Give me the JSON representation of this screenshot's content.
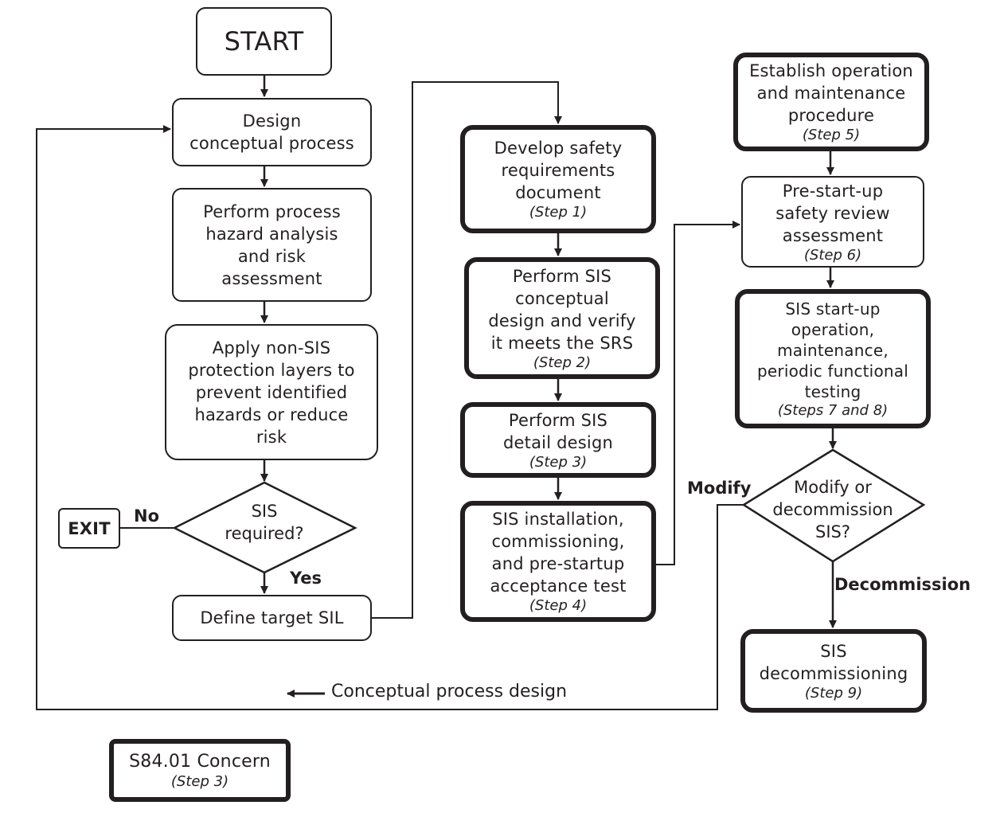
{
  "diagram": {
    "colors": {
      "stroke": "#231f20",
      "background": "#ffffff"
    },
    "nodes": {
      "start": {
        "text": "START"
      },
      "design": {
        "text": "Design\nconceptual process"
      },
      "hazard": {
        "text": "Perform process\nhazard analysis\nand risk\nassessment"
      },
      "nonsis": {
        "text": "Apply non-SIS\nprotection layers to\nprevent identified\nhazards or reduce\nrisk"
      },
      "sis_required": {
        "text": "SIS\nrequired?"
      },
      "exit": {
        "text": "EXIT"
      },
      "define_sil": {
        "text": "Define target SIL"
      },
      "step1": {
        "text": "Develop safety\nrequirements\ndocument",
        "step": "(Step 1)"
      },
      "step2": {
        "text": "Perform SIS\nconceptual\ndesign and verify\nit meets the SRS",
        "step": "(Step 2)"
      },
      "step3": {
        "text": "Perform SIS\ndetail design",
        "step": "(Step 3)"
      },
      "step4": {
        "text": "SIS installation,\ncommissioning,\nand pre-startup\nacceptance test",
        "step": "(Step 4)"
      },
      "step5": {
        "text": "Establish operation\nand maintenance\nprocedure",
        "step": "(Step 5)"
      },
      "step6": {
        "text": "Pre-start-up\nsafety review\nassessment",
        "step": "(Step 6)"
      },
      "step78": {
        "text": "SIS start-up\noperation,\nmaintenance,\nperiodic functional\ntesting",
        "step": "(Steps 7 and 8)"
      },
      "modify_decision": {
        "text": "Modify or\ndecommission\nSIS?"
      },
      "step9": {
        "text": "SIS\ndecommissioning",
        "step": "(Step 9)"
      }
    },
    "edge_labels": {
      "no": "No",
      "yes": "Yes",
      "modify": "Modify",
      "decommission": "Decommission",
      "loop_back": "Conceptual process design"
    },
    "legend": {
      "text": "S84.01 Concern",
      "step": "(Step 3)"
    }
  }
}
